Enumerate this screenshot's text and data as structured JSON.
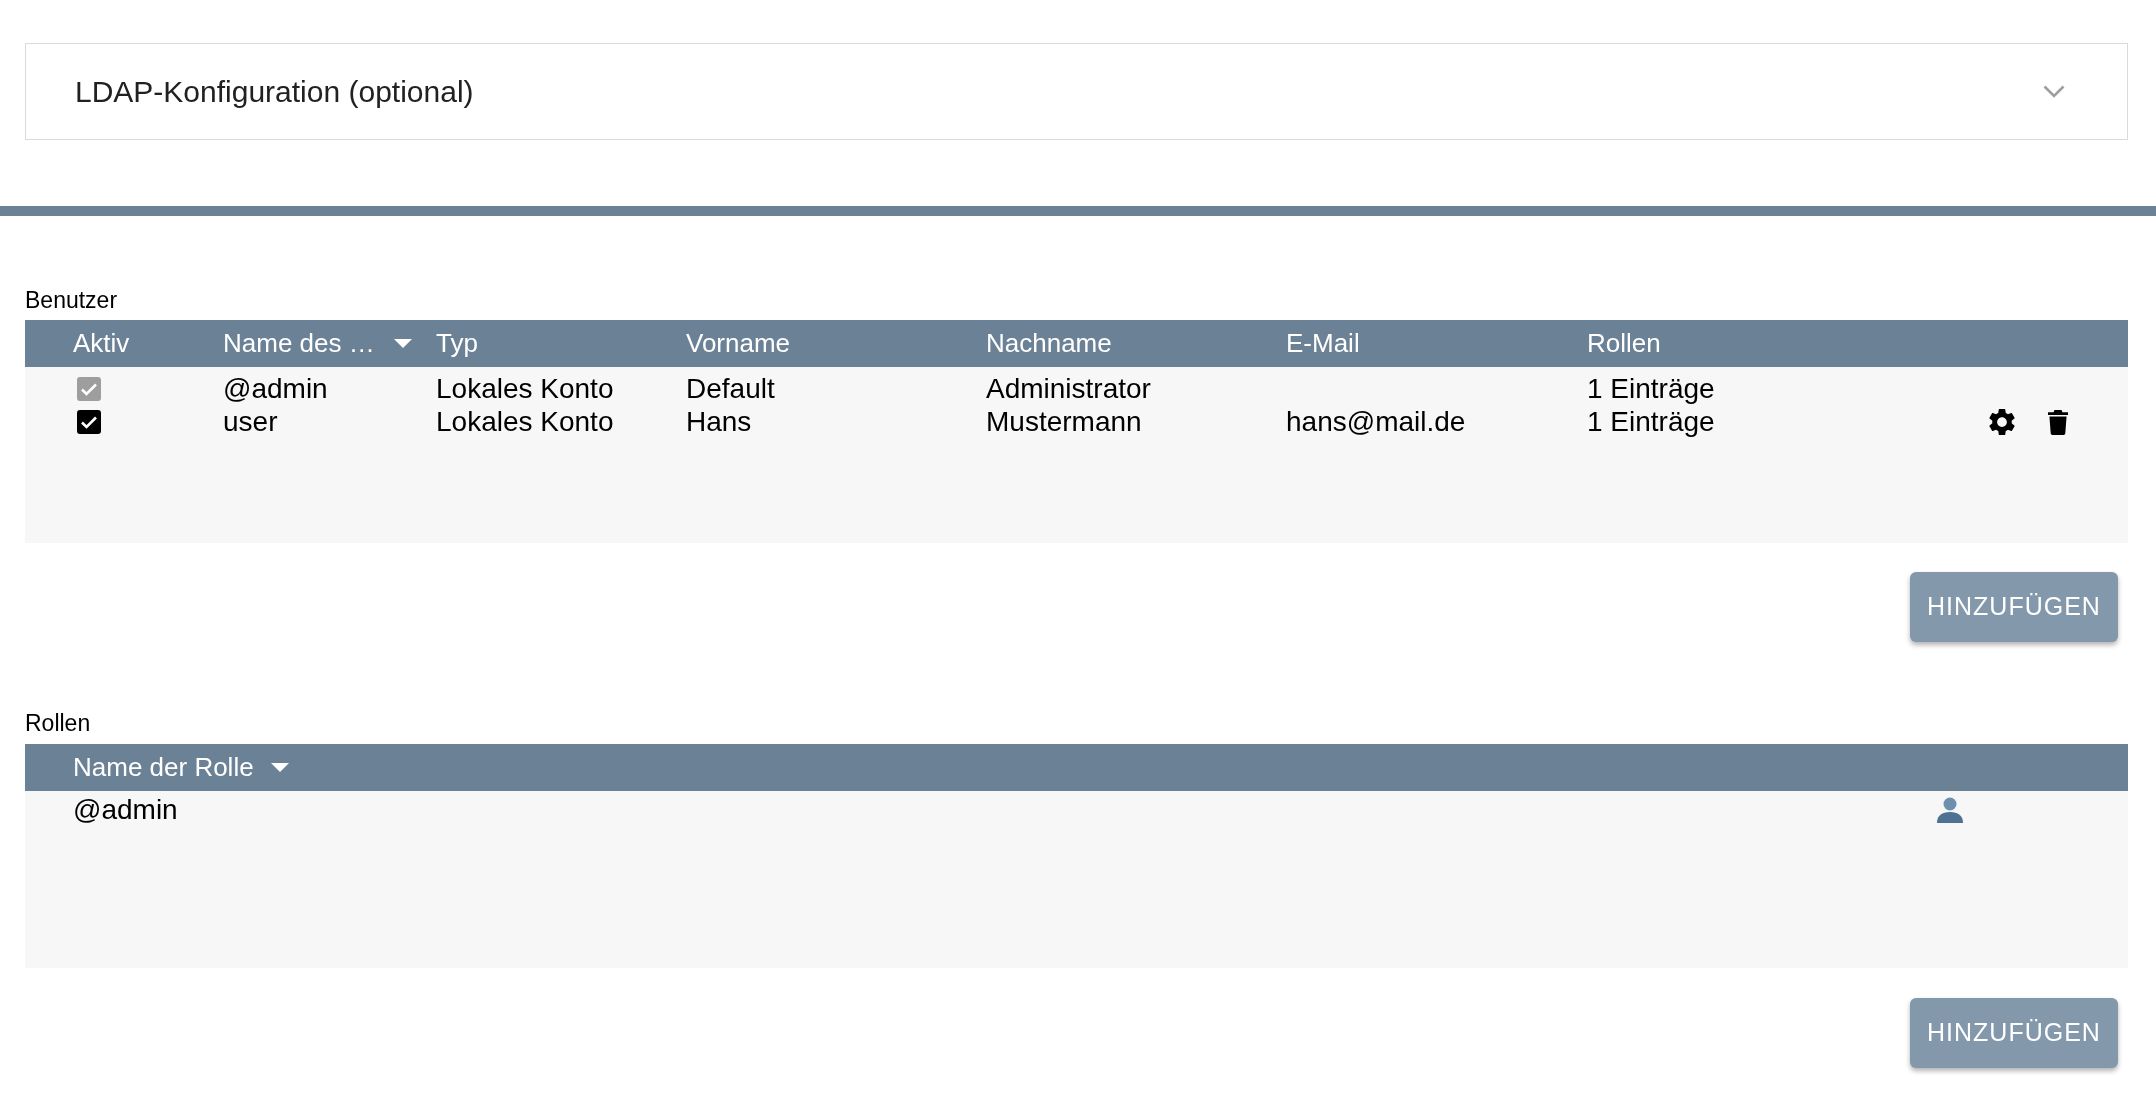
{
  "ldap_panel": {
    "title": "LDAP-Konfiguration (optional)",
    "expanded": false
  },
  "users": {
    "label": "Benutzer",
    "columns": [
      {
        "label": "Aktiv",
        "sorted": false
      },
      {
        "label": "Name des …",
        "sorted": true
      },
      {
        "label": "Typ",
        "sorted": false
      },
      {
        "label": "Vorname",
        "sorted": false
      },
      {
        "label": "Nachname",
        "sorted": false
      },
      {
        "label": "E-Mail",
        "sorted": false
      },
      {
        "label": "Rollen",
        "sorted": false
      }
    ],
    "rows": [
      {
        "active": true,
        "disabled": true,
        "name": "@admin",
        "type": "Lokales Konto",
        "first_name": "Default",
        "last_name": "Administrator",
        "roles": "1 Einträge",
        "editable": false
      },
      {
        "active": true,
        "disabled": false,
        "name": "user",
        "type": "Lokales Konto",
        "first_name": "Hans",
        "last_name": "Mustermann",
        "email": "hans@mail.de",
        "roles": "1 Einträge",
        "editable": true
      }
    ],
    "add_button": "HINZUFÜGEN"
  },
  "roles": {
    "label": "Rollen",
    "columns": [
      {
        "label": "Name der Rolle",
        "sorted": true
      }
    ],
    "rows": [
      {
        "name": "@admin"
      }
    ],
    "add_button": "HINZUFÜGEN"
  }
}
